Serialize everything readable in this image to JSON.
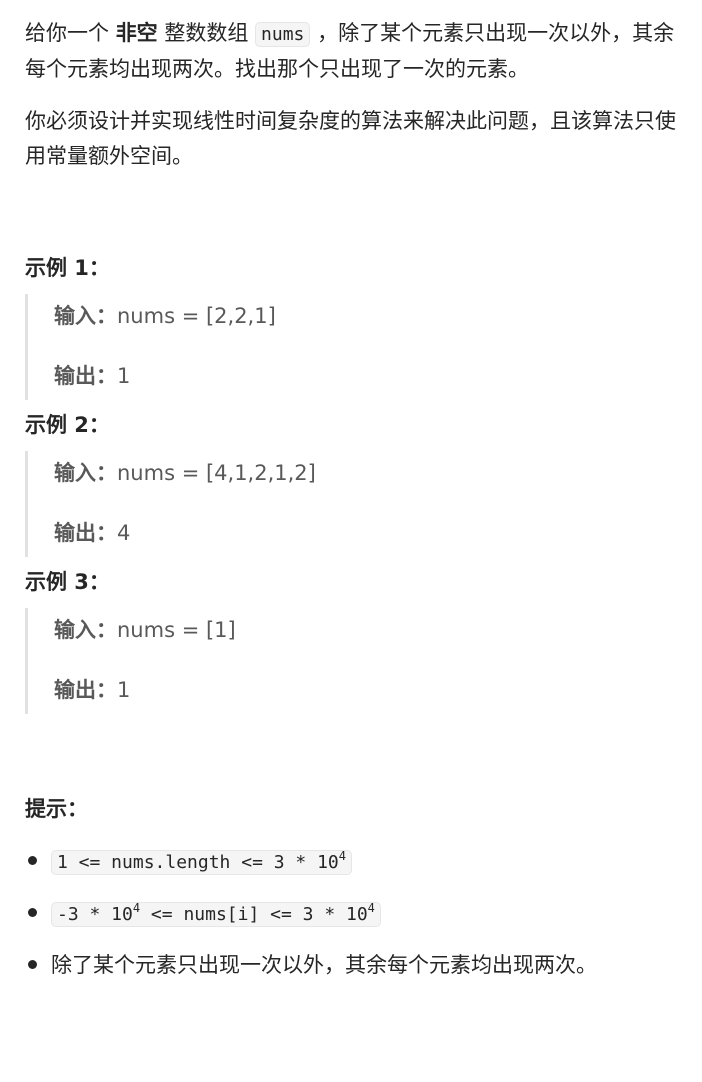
{
  "description": {
    "p1_pre": "给你一个 ",
    "p1_bold": "非空",
    "p1_mid": " 整数数组 ",
    "p1_code": "nums",
    "p1_post": " ，除了某个元素只出现一次以外，其余每个元素均出现两次。找出那个只出现了一次的元素。",
    "p2": "你必须设计并实现线性时间复杂度的算法来解决此问题，且该算法只使用常量额外空间。"
  },
  "examples": [
    {
      "title": "示例 1：",
      "input_label": "输入：",
      "input": "nums = [2,2,1]",
      "output_label": "输出：",
      "output": "1"
    },
    {
      "title": "示例 2：",
      "input_label": "输入：",
      "input": "nums = [4,1,2,1,2]",
      "output_label": "输出：",
      "output": "4"
    },
    {
      "title": "示例 3：",
      "input_label": "输入：",
      "input": "nums = [1]",
      "output_label": "输出：",
      "output": "1"
    }
  ],
  "hints": {
    "title": "提示：",
    "h1_a": "1 <= nums.length <= 3 * 10",
    "h1_sup": "4",
    "h2_a": "-3 * 10",
    "h2_sup1": "4",
    "h2_b": " <= nums[i] <= 3 * 10",
    "h2_sup2": "4",
    "h3": "除了某个元素只出现一次以外，其余每个元素均出现两次。"
  }
}
